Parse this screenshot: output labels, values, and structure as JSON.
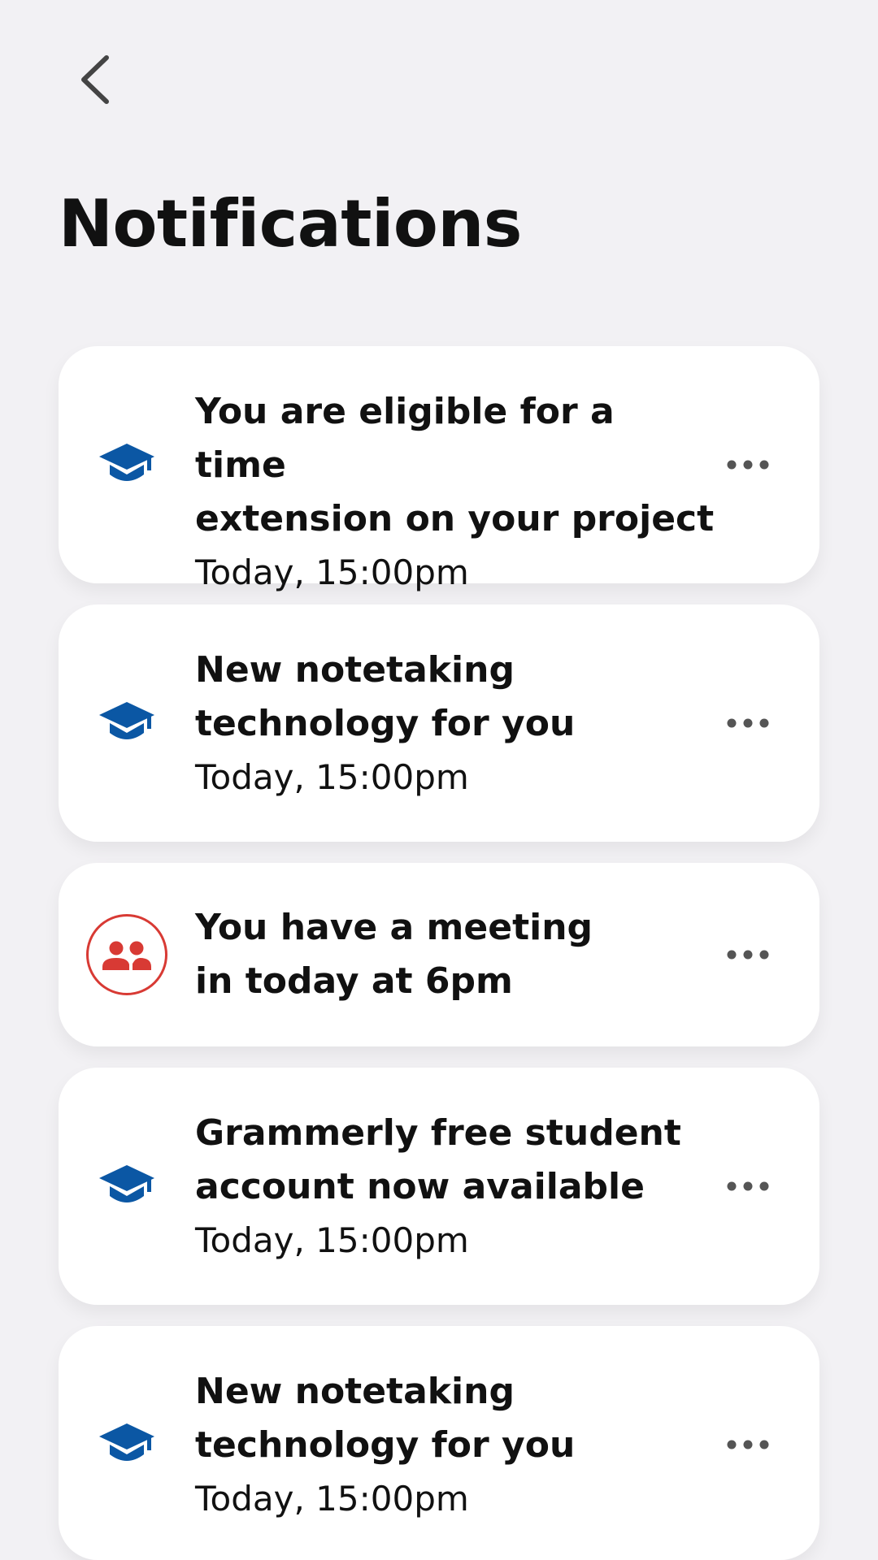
{
  "header": {
    "back_icon": "chevron-left-icon",
    "title": "Notifications"
  },
  "colors": {
    "background": "#f2f1f4",
    "card": "#ffffff",
    "education_icon": "#0b57a4",
    "meeting_icon": "#d83a34",
    "text": "#111111",
    "more_icon": "#555555"
  },
  "notifications": [
    {
      "icon": "graduation-cap-icon",
      "title": "You are eligible for a time\nextension on your project",
      "time": "Today, 15:00pm",
      "more_icon": "more-horizontal-icon"
    },
    {
      "icon": "graduation-cap-icon",
      "title": "New notetaking\ntechnology for you",
      "time": "Today, 15:00pm",
      "more_icon": "more-horizontal-icon"
    },
    {
      "icon": "group-icon",
      "title": "You have a meeting\nin today at 6pm",
      "time": "",
      "more_icon": "more-horizontal-icon"
    },
    {
      "icon": "graduation-cap-icon",
      "title": "Grammerly free student\naccount now available",
      "time": "Today, 15:00pm",
      "more_icon": "more-horizontal-icon"
    },
    {
      "icon": "graduation-cap-icon",
      "title": "New notetaking\ntechnology for you",
      "time": "Today, 15:00pm",
      "more_icon": "more-horizontal-icon"
    }
  ]
}
